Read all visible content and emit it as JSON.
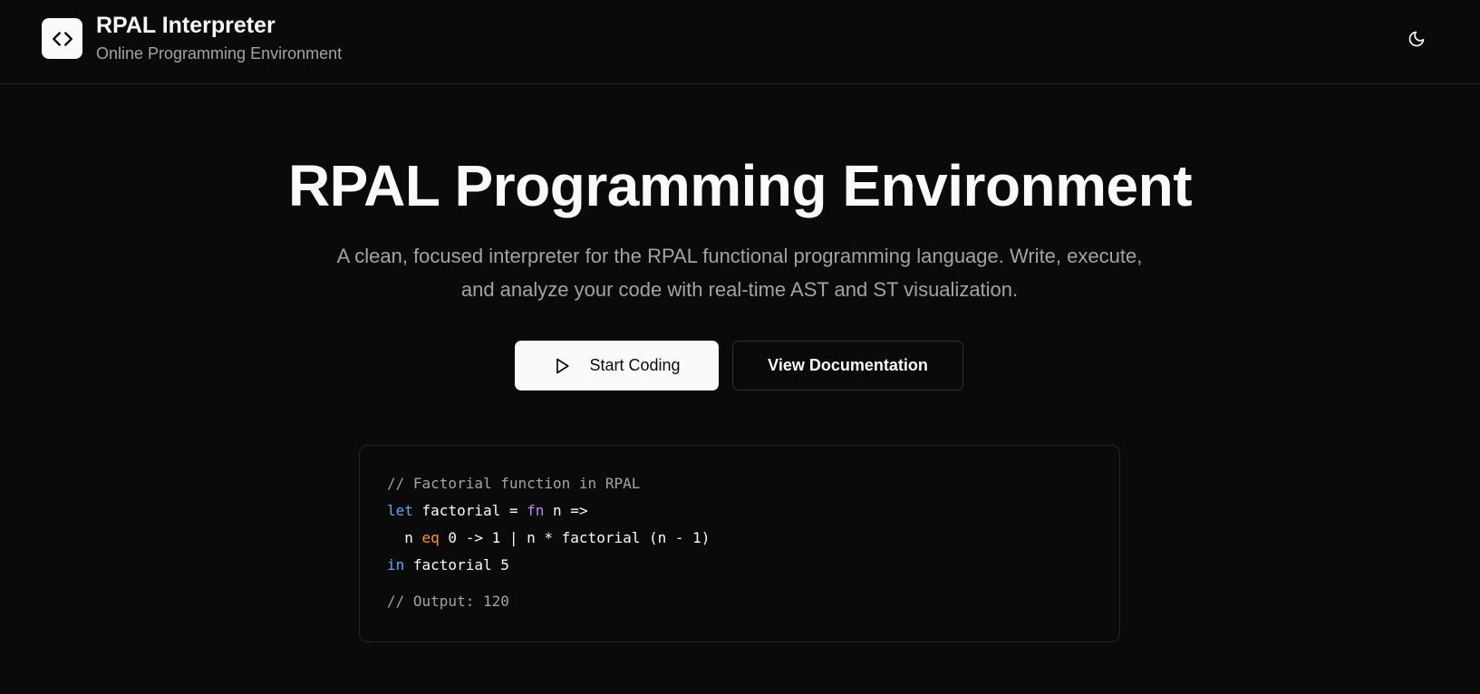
{
  "header": {
    "logo_icon": "code-brackets-icon",
    "title": "RPAL Interpreter",
    "subtitle": "Online Programming Environment",
    "theme_toggle_icon": "moon-icon"
  },
  "hero": {
    "title": "RPAL Programming Environment",
    "description": "A clean, focused interpreter for the RPAL functional programming language. Write, execute, and analyze your code with real-time AST and ST visualization.",
    "primary_button": {
      "label": "Start Coding",
      "icon": "play-icon"
    },
    "secondary_button": {
      "label": "View Documentation"
    }
  },
  "code_sample": {
    "comment": "// Factorial function in RPAL",
    "line1": {
      "kw_let": "let",
      "text1": " factorial = ",
      "kw_fn": "fn",
      "text2": " n =>"
    },
    "line2": {
      "text1": "  n ",
      "kw_eq": "eq",
      "text2": " 0 -> 1 | n * factorial (n - 1)"
    },
    "line3": {
      "kw_in": "in",
      "text1": " factorial 5"
    },
    "output": "// Output: 120"
  },
  "colors": {
    "background": "#0a0a0a",
    "foreground": "#fafafa",
    "muted": "#a3a3a3",
    "keyword_blue": "#60a5fa",
    "keyword_purple": "#c084fc",
    "keyword_orange": "#fb923c"
  }
}
